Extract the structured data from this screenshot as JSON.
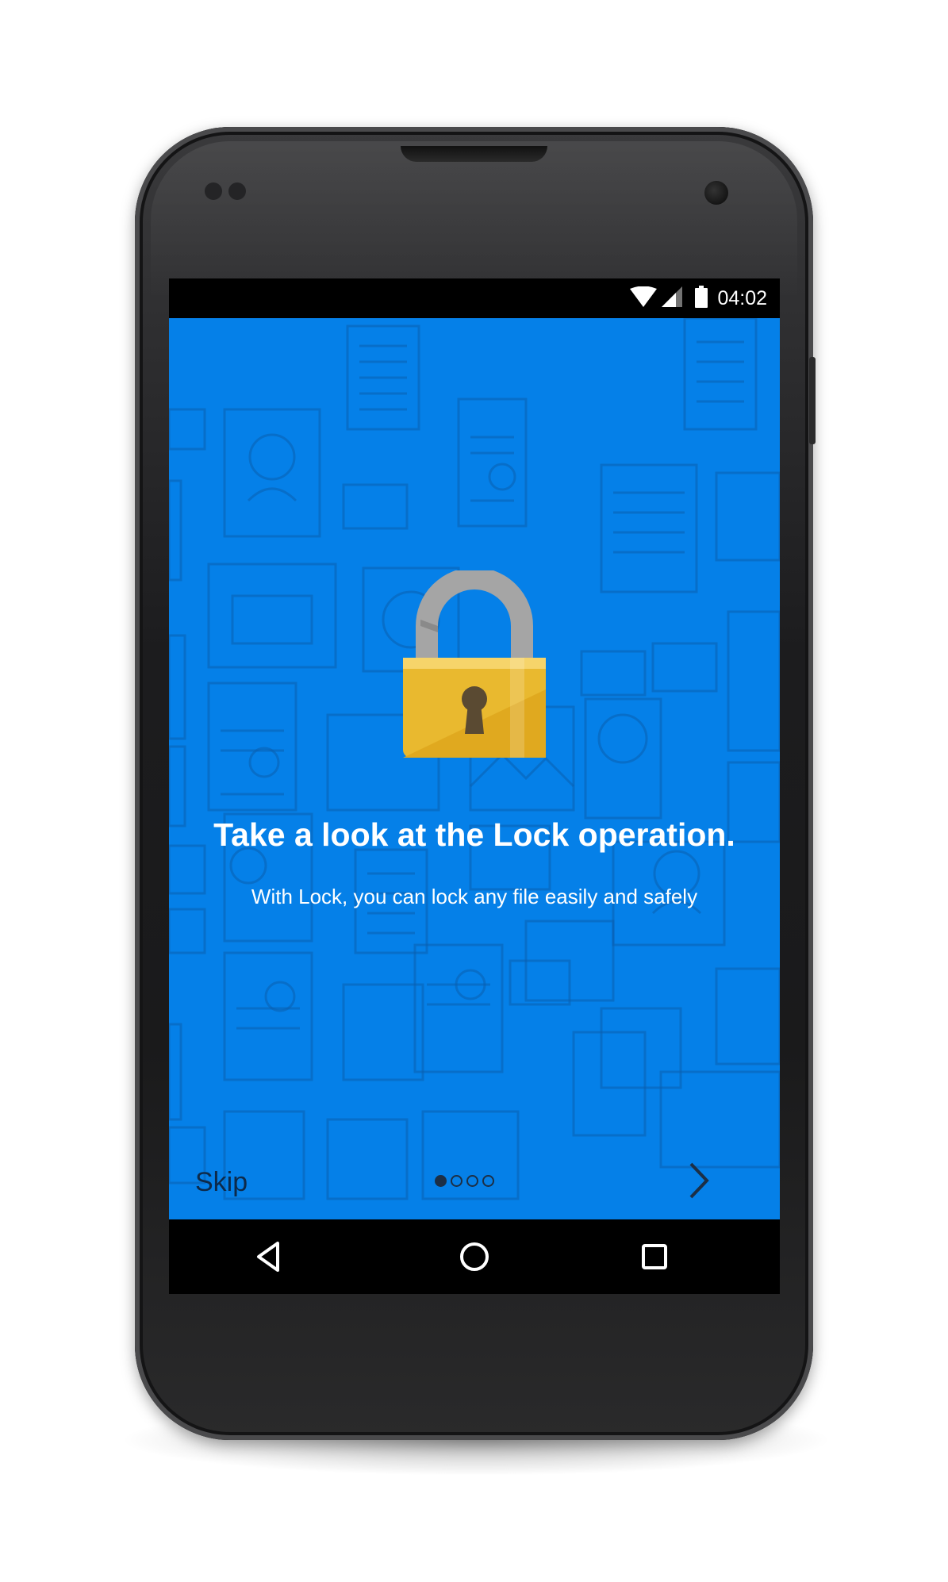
{
  "status_bar": {
    "time": "04:02",
    "icons": [
      "wifi-icon",
      "signal-icon",
      "battery-icon"
    ]
  },
  "onboarding": {
    "illustration": "unlocked-padlock-icon",
    "title": "Take a look at the Lock operation.",
    "subtitle": "With Lock, you can lock any file easily and safely",
    "skip_label": "Skip",
    "page_indicator": {
      "current": 1,
      "total": 4
    },
    "next_icon": "chevron-right-icon"
  },
  "nav_bar": {
    "buttons": [
      "back-icon",
      "home-icon",
      "recents-icon"
    ]
  },
  "colors": {
    "background": "#0580e8",
    "title_text": "#ffffff",
    "skip_text": "#0d2a4a",
    "lock_body": "#e9b92f",
    "shackle": "#a0a0a0"
  }
}
